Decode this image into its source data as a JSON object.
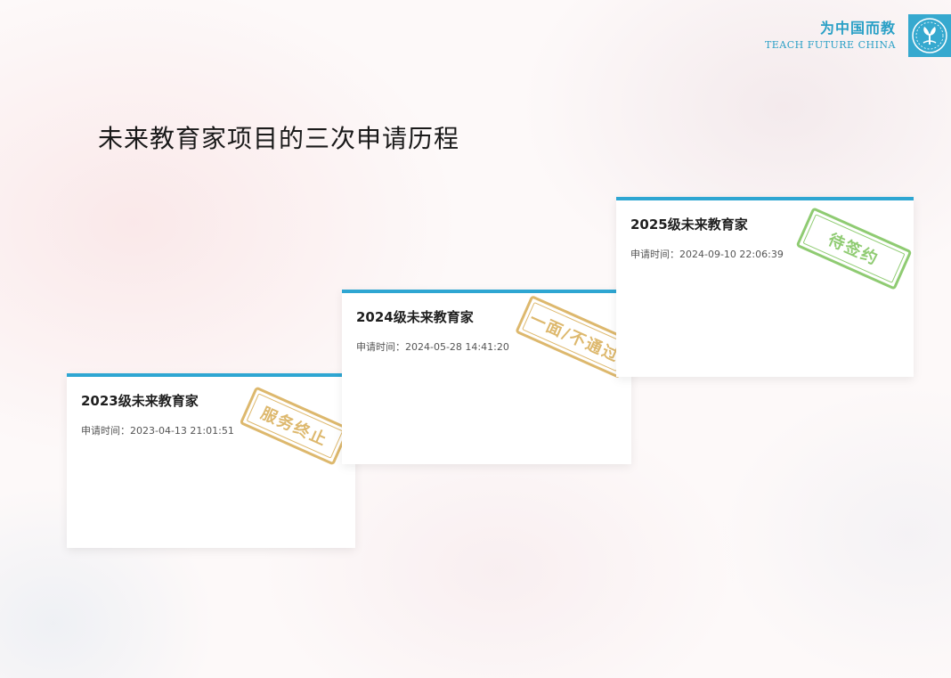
{
  "header": {
    "brand_cn": "为中国而教",
    "brand_en": "TEACH FUTURE CHINA",
    "logo_icon": "tree-emblem-icon"
  },
  "page": {
    "title": "未来教育家项目的三次申请历程"
  },
  "cards": [
    {
      "title": "2023级未来教育家",
      "meta_label": "申请时间：",
      "meta_value": "2023-04-13 21:01:51",
      "stamp": "服务终止",
      "stamp_color": "#d8ac54"
    },
    {
      "title": "2024级未来教育家",
      "meta_label": "申请时间：",
      "meta_value": "2024-05-28 14:41:20",
      "stamp": "一面/不通过",
      "stamp_color": "#d8ac54"
    },
    {
      "title": "2025级未来教育家",
      "meta_label": "申请时间：",
      "meta_value": "2024-09-10 22:06:39",
      "stamp": "待签约",
      "stamp_color": "#7cc35a"
    }
  ],
  "colors": {
    "accent": "#2ea6d2",
    "brand": "#2aa0c6"
  }
}
